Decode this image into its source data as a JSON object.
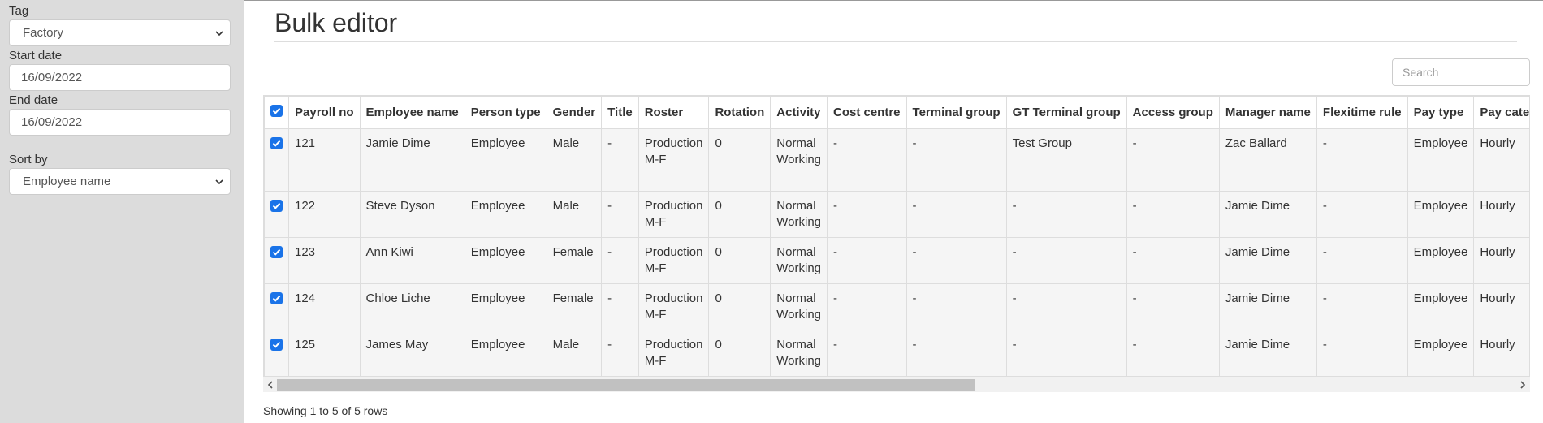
{
  "filters": {
    "tag_label": "Tag",
    "tag_value": "Factory",
    "start_label": "Start date",
    "start_value": "16/09/2022",
    "end_label": "End date",
    "end_value": "16/09/2022",
    "sort_label": "Sort by",
    "sort_value": "Employee name"
  },
  "page": {
    "title": "Bulk editor"
  },
  "search": {
    "placeholder": "Search"
  },
  "table": {
    "headers": [
      "Payroll no",
      "Employee name",
      "Person type",
      "Gender",
      "Title",
      "Roster",
      "Rotation",
      "Activity",
      "Cost centre",
      "Terminal group",
      "GT Terminal group",
      "Access group",
      "Manager name",
      "Flexitime rule",
      "Pay type",
      "Pay categ"
    ],
    "rows": [
      {
        "cells": [
          "121",
          "Jamie Dime",
          "Employee",
          "Male",
          "-",
          "Production M-F",
          "0",
          "Normal Working",
          "-",
          "-",
          "Test Group",
          "-",
          "Zac Ballard",
          "-",
          "Employee",
          "Hourly"
        ]
      },
      {
        "cells": [
          "122",
          "Steve Dyson",
          "Employee",
          "Male",
          "-",
          "Production M-F",
          "0",
          "Normal Working",
          "-",
          "-",
          "-",
          "-",
          "Jamie Dime",
          "-",
          "Employee",
          "Hourly"
        ]
      },
      {
        "cells": [
          "123",
          "Ann Kiwi",
          "Employee",
          "Female",
          "-",
          "Production M-F",
          "0",
          "Normal Working",
          "-",
          "-",
          "-",
          "-",
          "Jamie Dime",
          "-",
          "Employee",
          "Hourly"
        ]
      },
      {
        "cells": [
          "124",
          "Chloe Liche",
          "Employee",
          "Female",
          "-",
          "Production M-F",
          "0",
          "Normal Working",
          "-",
          "-",
          "-",
          "-",
          "Jamie Dime",
          "-",
          "Employee",
          "Hourly"
        ]
      },
      {
        "cells": [
          "125",
          "James May",
          "Employee",
          "Male",
          "-",
          "Production M-F",
          "0",
          "Normal Working",
          "-",
          "-",
          "-",
          "-",
          "Jamie Dime",
          "-",
          "Employee",
          "Hourly"
        ]
      }
    ]
  },
  "footer": {
    "text": "Showing 1 to 5 of 5 rows"
  },
  "colors": {
    "checkbox": "#1a73e8",
    "sidebar": "#dcdcdc",
    "row": "#f5f5f5"
  }
}
